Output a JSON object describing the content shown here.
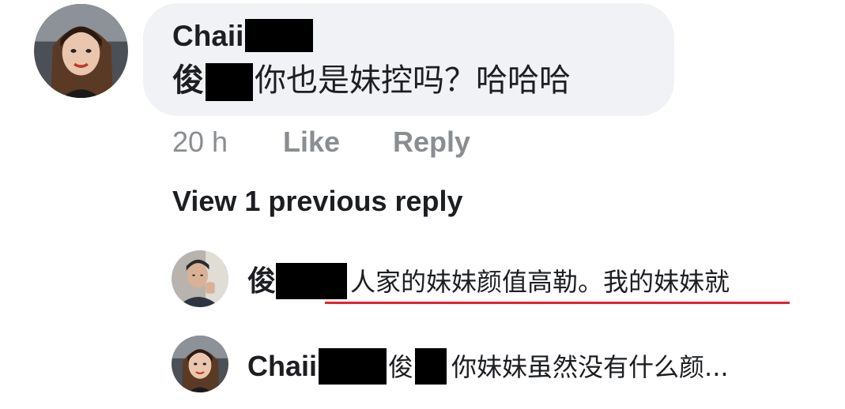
{
  "comment": {
    "author": "Chaii",
    "mention": "俊",
    "text": "你也是妹控吗？哈哈哈",
    "time": "20 h",
    "like_label": "Like",
    "reply_label": "Reply"
  },
  "view_previous": "View 1 previous reply",
  "replies": [
    {
      "author": "俊",
      "text": "人家的妹妹颜值高勒。我的妹妹就"
    },
    {
      "author": "Chaii",
      "mention": "俊",
      "text": "你妹妹虽然没有什么颜..."
    }
  ],
  "colors": {
    "bubble_bg": "#f0f2f5",
    "muted_text": "#8a8d91",
    "spellcheck_underline": "#e0242e",
    "redaction": "#000000"
  }
}
